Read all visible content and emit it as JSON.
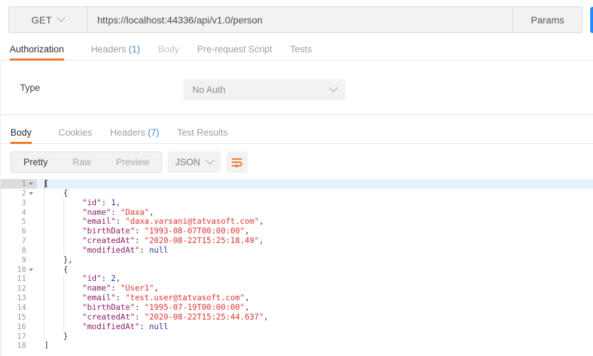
{
  "request_bar": {
    "method": "GET",
    "method_caret_icon": "chevron-down-icon",
    "url": "https://localhost:44336/api/v1.0/person",
    "params_label": "Params",
    "send_label": "",
    "send_color": "#1a8cff"
  },
  "request_tabs": [
    {
      "label": "Authorization",
      "count": "",
      "active": true,
      "dim": false
    },
    {
      "label": "Headers",
      "count": "(1)",
      "active": false,
      "dim": false
    },
    {
      "label": "Body",
      "count": "",
      "active": false,
      "dim": true
    },
    {
      "label": "Pre-request Script",
      "count": "",
      "active": false,
      "dim": false
    },
    {
      "label": "Tests",
      "count": "",
      "active": false,
      "dim": false
    }
  ],
  "authorization": {
    "type_label": "Type",
    "type_value": "No Auth",
    "type_caret_icon": "chevron-down-icon"
  },
  "response_tabs": [
    {
      "label": "Body",
      "count": "",
      "active": true,
      "dim": false
    },
    {
      "label": "Cookies",
      "count": "",
      "active": false,
      "dim": false
    },
    {
      "label": "Headers",
      "count": "(7)",
      "active": false,
      "dim": false
    },
    {
      "label": "Test Results",
      "count": "",
      "active": false,
      "dim": false
    }
  ],
  "response_toolbar": {
    "formats": [
      {
        "label": "Pretty",
        "active": true
      },
      {
        "label": "Raw",
        "active": false
      },
      {
        "label": "Preview",
        "active": false
      }
    ],
    "language": "JSON",
    "language_caret_icon": "chevron-down-icon",
    "wrap_icon": "word-wrap-icon",
    "wrap_icon_color": "#ef7623"
  },
  "editor": {
    "accent_color": "#ef7623",
    "active_line": 1,
    "lines": [
      {
        "n": "1",
        "fold": true,
        "indent": 0,
        "tokens": [
          {
            "t": "[",
            "c": "punc"
          }
        ]
      },
      {
        "n": "2",
        "fold": true,
        "indent": 1,
        "tokens": [
          {
            "t": "    {",
            "c": "punc"
          }
        ]
      },
      {
        "n": "3",
        "fold": false,
        "indent": 2,
        "tokens": [
          {
            "t": "        ",
            "c": "punc"
          },
          {
            "t": "\"id\"",
            "c": "key"
          },
          {
            "t": ": ",
            "c": "punc"
          },
          {
            "t": "1",
            "c": "num"
          },
          {
            "t": ",",
            "c": "punc"
          }
        ]
      },
      {
        "n": "4",
        "fold": false,
        "indent": 2,
        "tokens": [
          {
            "t": "        ",
            "c": "punc"
          },
          {
            "t": "\"name\"",
            "c": "key"
          },
          {
            "t": ": ",
            "c": "punc"
          },
          {
            "t": "\"Daxa\"",
            "c": "str"
          },
          {
            "t": ",",
            "c": "punc"
          }
        ]
      },
      {
        "n": "5",
        "fold": false,
        "indent": 2,
        "tokens": [
          {
            "t": "        ",
            "c": "punc"
          },
          {
            "t": "\"email\"",
            "c": "key"
          },
          {
            "t": ": ",
            "c": "punc"
          },
          {
            "t": "\"daxa.varsani@tatvasoft.com\"",
            "c": "str"
          },
          {
            "t": ",",
            "c": "punc"
          }
        ]
      },
      {
        "n": "6",
        "fold": false,
        "indent": 2,
        "tokens": [
          {
            "t": "        ",
            "c": "punc"
          },
          {
            "t": "\"birthDate\"",
            "c": "key"
          },
          {
            "t": ": ",
            "c": "punc"
          },
          {
            "t": "\"1993-08-07T00:00:00\"",
            "c": "str"
          },
          {
            "t": ",",
            "c": "punc"
          }
        ]
      },
      {
        "n": "7",
        "fold": false,
        "indent": 2,
        "tokens": [
          {
            "t": "        ",
            "c": "punc"
          },
          {
            "t": "\"createdAt\"",
            "c": "key"
          },
          {
            "t": ": ",
            "c": "punc"
          },
          {
            "t": "\"2020-08-22T15:25:18.49\"",
            "c": "str"
          },
          {
            "t": ",",
            "c": "punc"
          }
        ]
      },
      {
        "n": "8",
        "fold": false,
        "indent": 2,
        "tokens": [
          {
            "t": "        ",
            "c": "punc"
          },
          {
            "t": "\"modifiedAt\"",
            "c": "key"
          },
          {
            "t": ": ",
            "c": "punc"
          },
          {
            "t": "null",
            "c": "null"
          }
        ]
      },
      {
        "n": "9",
        "fold": false,
        "indent": 1,
        "tokens": [
          {
            "t": "    },",
            "c": "punc"
          }
        ]
      },
      {
        "n": "10",
        "fold": true,
        "indent": 1,
        "tokens": [
          {
            "t": "    {",
            "c": "punc"
          }
        ]
      },
      {
        "n": "11",
        "fold": false,
        "indent": 2,
        "tokens": [
          {
            "t": "        ",
            "c": "punc"
          },
          {
            "t": "\"id\"",
            "c": "key"
          },
          {
            "t": ": ",
            "c": "punc"
          },
          {
            "t": "2",
            "c": "num"
          },
          {
            "t": ",",
            "c": "punc"
          }
        ]
      },
      {
        "n": "12",
        "fold": false,
        "indent": 2,
        "tokens": [
          {
            "t": "        ",
            "c": "punc"
          },
          {
            "t": "\"name\"",
            "c": "key"
          },
          {
            "t": ": ",
            "c": "punc"
          },
          {
            "t": "\"User1\"",
            "c": "str"
          },
          {
            "t": ",",
            "c": "punc"
          }
        ]
      },
      {
        "n": "13",
        "fold": false,
        "indent": 2,
        "tokens": [
          {
            "t": "        ",
            "c": "punc"
          },
          {
            "t": "\"email\"",
            "c": "key"
          },
          {
            "t": ": ",
            "c": "punc"
          },
          {
            "t": "\"test.user@tatvasoft.com\"",
            "c": "str"
          },
          {
            "t": ",",
            "c": "punc"
          }
        ]
      },
      {
        "n": "14",
        "fold": false,
        "indent": 2,
        "tokens": [
          {
            "t": "        ",
            "c": "punc"
          },
          {
            "t": "\"birthDate\"",
            "c": "key"
          },
          {
            "t": ": ",
            "c": "punc"
          },
          {
            "t": "\"1995-07-19T00:00:00\"",
            "c": "str"
          },
          {
            "t": ",",
            "c": "punc"
          }
        ]
      },
      {
        "n": "15",
        "fold": false,
        "indent": 2,
        "tokens": [
          {
            "t": "        ",
            "c": "punc"
          },
          {
            "t": "\"createdAt\"",
            "c": "key"
          },
          {
            "t": ": ",
            "c": "punc"
          },
          {
            "t": "\"2020-08-22T15:25:44.637\"",
            "c": "str"
          },
          {
            "t": ",",
            "c": "punc"
          }
        ]
      },
      {
        "n": "16",
        "fold": false,
        "indent": 2,
        "tokens": [
          {
            "t": "        ",
            "c": "punc"
          },
          {
            "t": "\"modifiedAt\"",
            "c": "key"
          },
          {
            "t": ": ",
            "c": "punc"
          },
          {
            "t": "null",
            "c": "null"
          }
        ]
      },
      {
        "n": "17",
        "fold": false,
        "indent": 1,
        "tokens": [
          {
            "t": "    }",
            "c": "punc"
          }
        ]
      },
      {
        "n": "18",
        "fold": false,
        "indent": 0,
        "tokens": [
          {
            "t": "]",
            "c": "punc"
          }
        ]
      }
    ]
  }
}
